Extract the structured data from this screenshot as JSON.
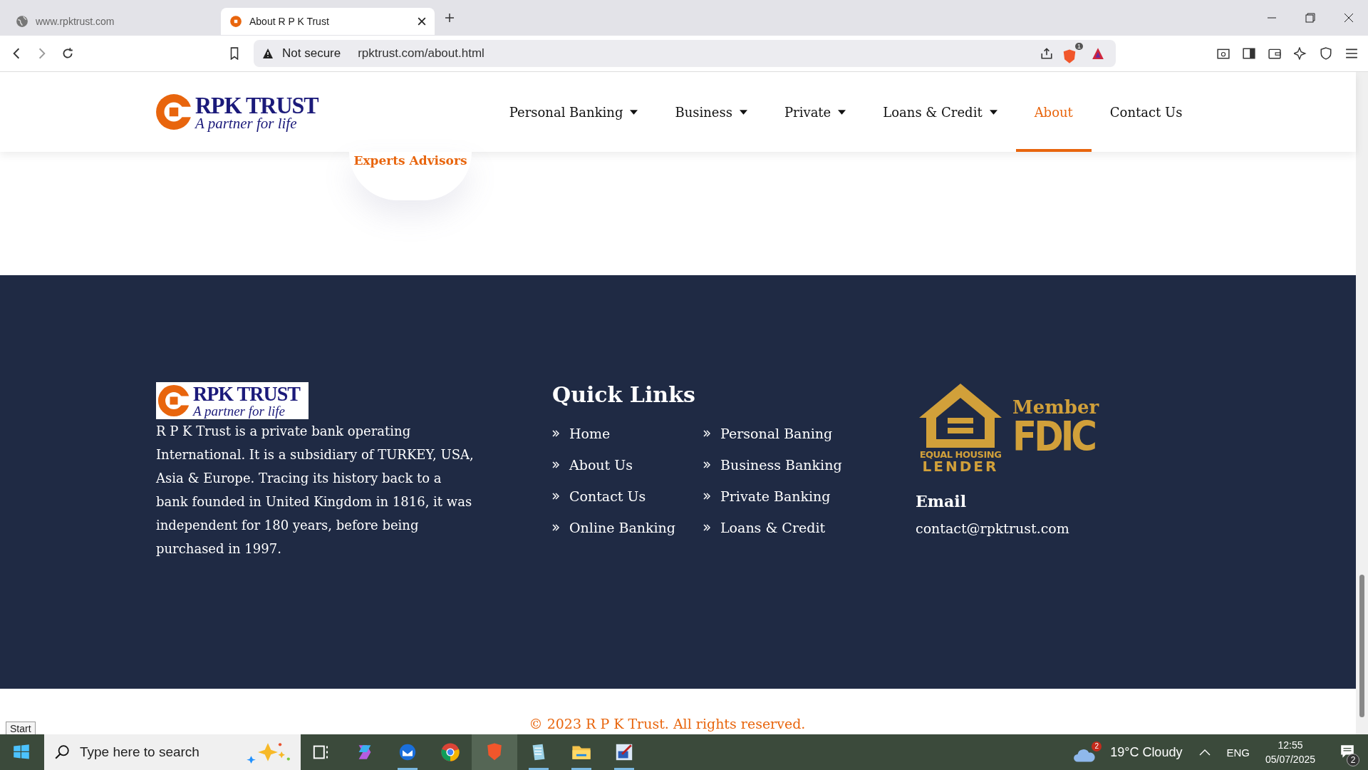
{
  "browser": {
    "tabs": [
      {
        "title": "www.rpktrust.com",
        "selected": false
      },
      {
        "title": "About R P K Trust",
        "selected": true
      }
    ],
    "security": "Not secure",
    "url": "rpktrust.com/about.html",
    "shields_count": "1"
  },
  "header": {
    "logo": {
      "name": "RPK TRUST",
      "tagline": "A partner for life"
    },
    "nav": [
      {
        "label": "Personal Banking",
        "dropdown": true,
        "selected": false
      },
      {
        "label": "Business",
        "dropdown": true,
        "selected": false
      },
      {
        "label": "Private",
        "dropdown": true,
        "selected": false
      },
      {
        "label": "Loans & Credit",
        "dropdown": true,
        "selected": false
      },
      {
        "label": "About",
        "dropdown": false,
        "selected": true
      },
      {
        "label": "Contact Us",
        "dropdown": false,
        "selected": false
      }
    ]
  },
  "feature": {
    "label": "Experts Advisors"
  },
  "footer": {
    "logo": {
      "name": "RPK TRUST",
      "tagline": "A partner for life"
    },
    "about": "R P K Trust is a private bank operating International. It is a subsidiary of TURKEY, USA, Asia & Europe. Tracing its history back to a bank founded in United Kingdom in 1816, it was independent for 180 years, before being purchased in 1997.",
    "quick_links_title": "Quick Links",
    "quick_links": [
      "Home",
      "Personal Baning",
      "About Us",
      "Business Banking",
      "Contact Us",
      "Private Banking",
      "Online Banking",
      "Loans & Credit"
    ],
    "badge": {
      "housing": "EQUAL HOUSING",
      "lender": "LENDER",
      "member": "Member",
      "fdic": "FDIC"
    },
    "email_title": "Email",
    "email": "contact@rpktrust.com"
  },
  "copyright": "© 2023 R P K Trust. All rights reserved.",
  "tooltip": "Start",
  "taskbar": {
    "search_placeholder": "Type here to search",
    "weather_badge": "2",
    "weather": "19°C  Cloudy",
    "language": "ENG",
    "time": "12:55",
    "date": "05/07/2025",
    "notifications": "2"
  }
}
